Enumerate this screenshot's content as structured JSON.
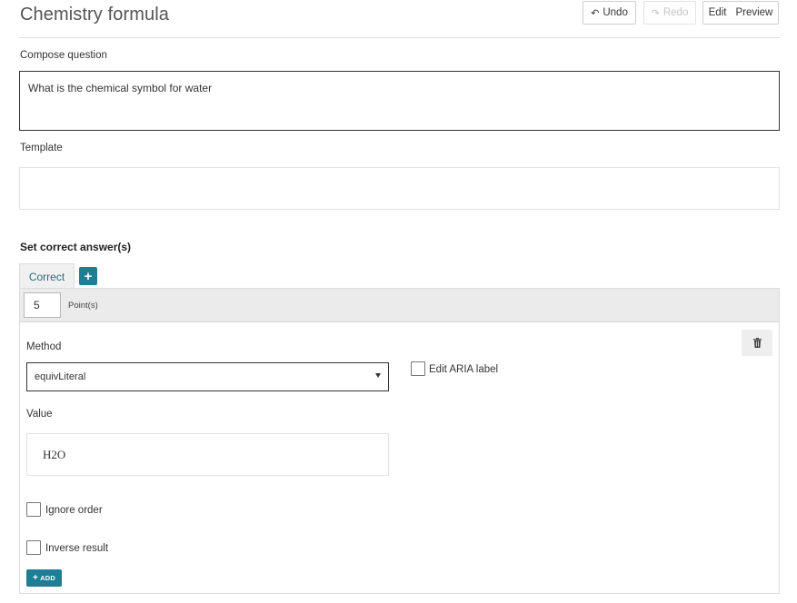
{
  "header": {
    "title": "Chemistry formula",
    "undo_label": "Undo",
    "redo_label": "Redo",
    "edit_label": "Edit",
    "preview_label": "Preview"
  },
  "compose": {
    "label": "Compose question",
    "value": "What is the chemical symbol for water"
  },
  "template": {
    "label": "Template",
    "value": ""
  },
  "answers": {
    "heading": "Set correct answer(s)",
    "tabs": [
      {
        "label": "Correct",
        "active": true
      }
    ],
    "add_tab_icon": "plus-icon",
    "points_value": "5",
    "points_label": "Point(s)",
    "method": {
      "label": "Method",
      "selected": "equivLiteral"
    },
    "edit_aria_label": "Edit ARIA label",
    "value": {
      "label": "Value",
      "content": "H2O"
    },
    "ignore_order_label": "Ignore order",
    "inverse_result_label": "Inverse result",
    "add_label": "ADD",
    "delete_icon": "trash-icon"
  },
  "colors": {
    "accent": "#1f7d95",
    "tab_text": "#2a6b80",
    "points_bar": "#ebebeb"
  }
}
